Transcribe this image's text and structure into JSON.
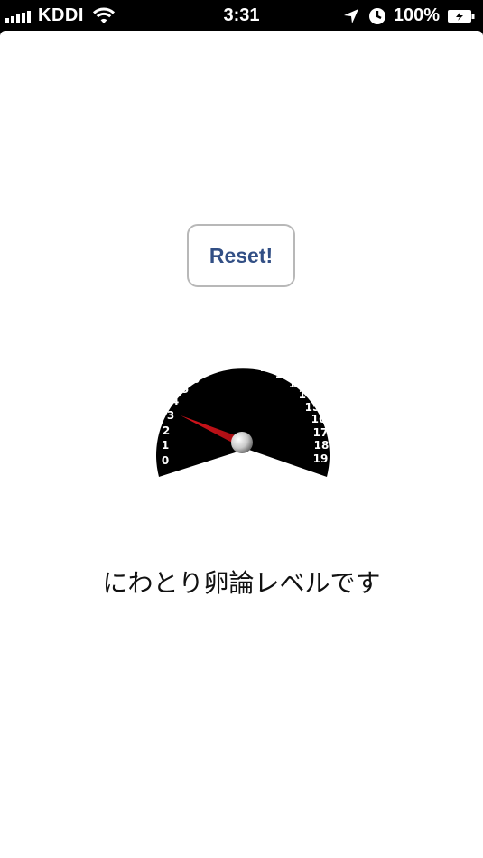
{
  "status_bar": {
    "carrier": "KDDI",
    "time": "3:31",
    "battery": "100%"
  },
  "reset_button": {
    "label": "Reset!"
  },
  "gauge": {
    "ticks": [
      "0",
      "1",
      "2",
      "3",
      "4",
      "5",
      "6",
      "7",
      "8",
      "9",
      "10",
      "11",
      "12",
      "13",
      "14",
      "15",
      "16",
      "17",
      "18",
      "19"
    ],
    "needle_value": 3,
    "colors": {
      "face": "#000000",
      "numbers": "#ffffff",
      "needle": "#d8141c"
    }
  },
  "level_text": "にわとり卵論レベルです"
}
